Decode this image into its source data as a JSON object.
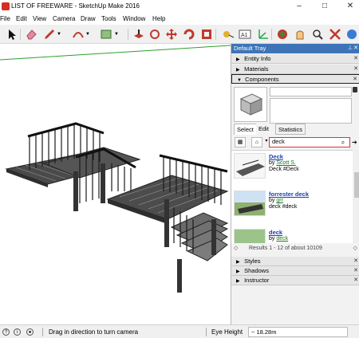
{
  "window": {
    "title": "LIST OF FREEWARE - SketchUp Make 2016",
    "minimize": "–",
    "maximize": "□",
    "close": "✕"
  },
  "menu": [
    "File",
    "Edit",
    "View",
    "Camera",
    "Draw",
    "Tools",
    "Window",
    "Help"
  ],
  "toolbar": {
    "icons": [
      "select-arrow-icon",
      "eraser-icon",
      "pencil-icon",
      "arc-icon",
      "rectangle-icon",
      "push-pull-icon",
      "rotate-icon",
      "move-icon",
      "follow-me-icon",
      "offset-icon",
      "tape-measure-icon",
      "text-icon",
      "axes-icon",
      "orbit-icon",
      "pan-icon",
      "zoom-icon",
      "zoom-extents-icon"
    ]
  },
  "tray": {
    "title": "Default Tray",
    "panels": {
      "entity_info": "Entity Info",
      "materials": "Materials",
      "components": "Components",
      "styles": "Styles",
      "shadows": "Shadows",
      "instructor": "Instructor"
    },
    "tabs": {
      "select": "Select",
      "edit": "Edit",
      "statistics": "Statistics"
    },
    "search_value": "deck",
    "results": [
      {
        "name": "Deck",
        "by_label": "by",
        "author": "Scott S.",
        "tag": "Deck #Deck"
      },
      {
        "name": "forrester deck",
        "by_label": "by",
        "author": "grr",
        "tag": "deck #deck"
      },
      {
        "name": "deck",
        "by_label": "by",
        "author": "deck",
        "tag": ""
      }
    ],
    "results_footer": "Results 1 - 12 of about 10109"
  },
  "statusbar": {
    "hint": "Drag in direction to turn camera",
    "eye_label": "Eye Height",
    "eye_value": "~ 18.28m"
  },
  "colors": {
    "tray_title_bg": "#3d74b8",
    "search_border": "#dd3333",
    "link_blue": "#1b3fb0",
    "link_green": "#1b7a1b"
  }
}
